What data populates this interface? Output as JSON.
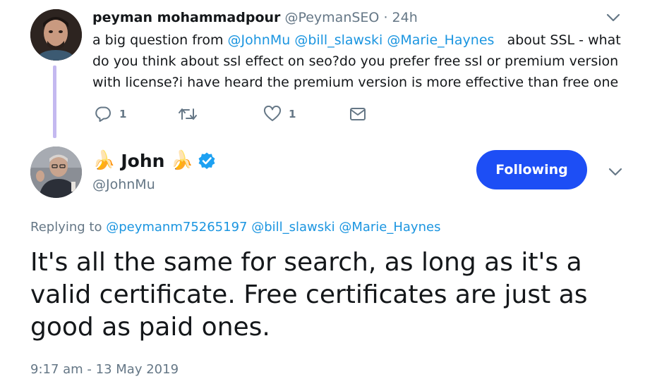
{
  "parent_tweet": {
    "name": "peyman mohammadpour",
    "handle": "@PeymanSEO",
    "separator": "·",
    "time": "24h",
    "text_parts": {
      "intro": "a big question from ",
      "mention_1": "@JohnMu",
      "mention_2": "@bill_slawski",
      "mention_3": "@Marie_Haynes",
      "body": "about SSL - what do you think about ssl effect on seo?do you prefer  free ssl or premium version with license?i have heard the premium  version is more effective than free one"
    },
    "actions": {
      "reply_count": "1",
      "retweet_count": "",
      "like_count": "1"
    }
  },
  "main_tweet": {
    "name": "John",
    "name_emoji": "🍌",
    "handle": "@JohnMu",
    "follow_button_label": "Following",
    "replying_prefix": "Replying to ",
    "replying_mentions": [
      "@peymanm75265197",
      "@bill_slawski",
      "@Marie_Haynes"
    ],
    "text": "It's all the same for search, as long as it's a valid certificate. Free certificates are just as good as paid ones.",
    "timestamp": "9:17 am - 13 May 2019"
  },
  "colors": {
    "link": "#1b95e0",
    "muted": "#657786",
    "follow_button": "#1d4ef5",
    "thread_line": "#c4b9f0",
    "verified": "#1da1f2"
  }
}
